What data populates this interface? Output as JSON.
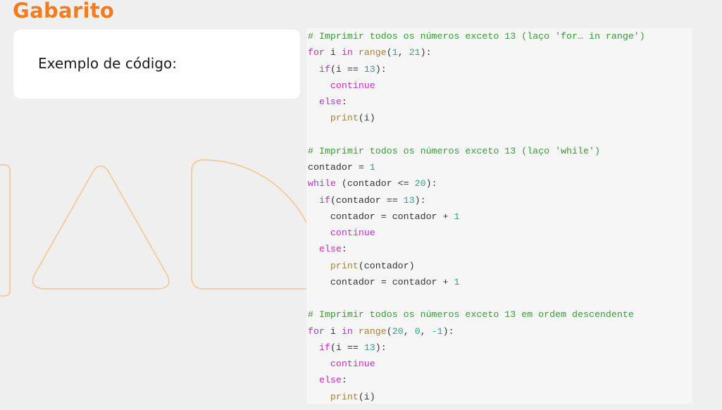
{
  "page": {
    "title": "Gabarito",
    "card_label": "Exemplo de código:"
  },
  "colors": {
    "title": "#f47c20",
    "shape_stroke": "#f7c38f",
    "comment": "#3a9a3a",
    "keyword": "#c231c2",
    "builtin": "#a67f3c",
    "number": "#3c9b8c",
    "default": "#333333"
  },
  "decor": {
    "shapes": [
      "rounded-rectangle-outline",
      "rounded-triangle-outline",
      "quarter-circle-outline"
    ]
  },
  "code": {
    "lines": [
      [
        [
          "comment",
          "# Imprimir todos os números exceto 13 (laço 'for… in range')"
        ]
      ],
      [
        [
          "keyword",
          "for"
        ],
        [
          "default",
          " i "
        ],
        [
          "keyword",
          "in"
        ],
        [
          "default",
          " "
        ],
        [
          "builtin",
          "range"
        ],
        [
          "default",
          "("
        ],
        [
          "number",
          "1"
        ],
        [
          "default",
          ", "
        ],
        [
          "number",
          "21"
        ],
        [
          "default",
          "):"
        ]
      ],
      [
        [
          "default",
          "  "
        ],
        [
          "keyword",
          "if"
        ],
        [
          "default",
          "(i == "
        ],
        [
          "number",
          "13"
        ],
        [
          "default",
          "):"
        ]
      ],
      [
        [
          "default",
          "    "
        ],
        [
          "keyword",
          "continue"
        ]
      ],
      [
        [
          "default",
          "  "
        ],
        [
          "keyword",
          "else"
        ],
        [
          "default",
          ":"
        ]
      ],
      [
        [
          "default",
          "    "
        ],
        [
          "builtin",
          "print"
        ],
        [
          "default",
          "(i)"
        ]
      ],
      [],
      [
        [
          "comment",
          "# Imprimir todos os números exceto 13 (laço 'while')"
        ]
      ],
      [
        [
          "default",
          "contador = "
        ],
        [
          "number",
          "1"
        ]
      ],
      [
        [
          "keyword",
          "while"
        ],
        [
          "default",
          " (contador <= "
        ],
        [
          "number",
          "20"
        ],
        [
          "default",
          "):"
        ]
      ],
      [
        [
          "default",
          "  "
        ],
        [
          "keyword",
          "if"
        ],
        [
          "default",
          "(contador == "
        ],
        [
          "number",
          "13"
        ],
        [
          "default",
          "):"
        ]
      ],
      [
        [
          "default",
          "    contador = contador + "
        ],
        [
          "number",
          "1"
        ]
      ],
      [
        [
          "default",
          "    "
        ],
        [
          "keyword",
          "continue"
        ]
      ],
      [
        [
          "default",
          "  "
        ],
        [
          "keyword",
          "else"
        ],
        [
          "default",
          ":"
        ]
      ],
      [
        [
          "default",
          "    "
        ],
        [
          "builtin",
          "print"
        ],
        [
          "default",
          "(contador)"
        ]
      ],
      [
        [
          "default",
          "    contador = contador + "
        ],
        [
          "number",
          "1"
        ]
      ],
      [],
      [
        [
          "comment",
          "# Imprimir todos os números exceto 13 em ordem descendente"
        ]
      ],
      [
        [
          "keyword",
          "for"
        ],
        [
          "default",
          " i "
        ],
        [
          "keyword",
          "in"
        ],
        [
          "default",
          " "
        ],
        [
          "builtin",
          "range"
        ],
        [
          "default",
          "("
        ],
        [
          "number",
          "20"
        ],
        [
          "default",
          ", "
        ],
        [
          "number",
          "0"
        ],
        [
          "default",
          ", "
        ],
        [
          "number",
          "-1"
        ],
        [
          "default",
          "):"
        ]
      ],
      [
        [
          "default",
          "  "
        ],
        [
          "keyword",
          "if"
        ],
        [
          "default",
          "(i == "
        ],
        [
          "number",
          "13"
        ],
        [
          "default",
          "):"
        ]
      ],
      [
        [
          "default",
          "    "
        ],
        [
          "keyword",
          "continue"
        ]
      ],
      [
        [
          "default",
          "  "
        ],
        [
          "keyword",
          "else"
        ],
        [
          "default",
          ":"
        ]
      ],
      [
        [
          "default",
          "    "
        ],
        [
          "builtin",
          "print"
        ],
        [
          "default",
          "(i)"
        ]
      ]
    ]
  }
}
